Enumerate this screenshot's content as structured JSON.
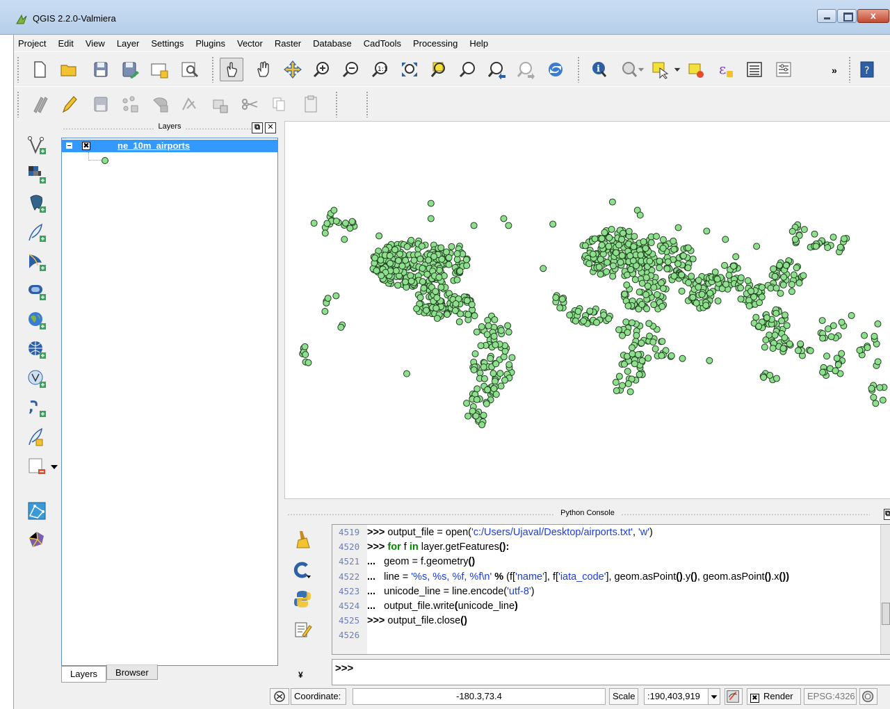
{
  "window": {
    "title": "QGIS 2.2.0-Valmiera"
  },
  "menu": [
    "Project",
    "Edit",
    "View",
    "Layer",
    "Settings",
    "Plugins",
    "Vector",
    "Raster",
    "Database",
    "CadTools",
    "Processing",
    "Help"
  ],
  "toolbar": {
    "file_icons": [
      "new-project-icon",
      "open-project-icon",
      "save-project-icon",
      "save-as-icon",
      "new-print-composer-icon",
      "composer-manager-icon"
    ],
    "nav_icons": [
      "touch-zoom-pan-icon",
      "pan-icon",
      "pan-to-selection-icon",
      "zoom-in-icon",
      "zoom-out-icon",
      "zoom-native-icon",
      "zoom-full-icon",
      "zoom-to-selection-icon",
      "zoom-to-layer-icon",
      "zoom-last-icon",
      "zoom-next-icon",
      "refresh-icon"
    ],
    "attr_icons": [
      "identify-icon",
      "feature-action-icon",
      "select-icon",
      "deselect-icon",
      "field-calculator-icon",
      "attribute-table-icon",
      "measure-icon"
    ],
    "more_label": "»",
    "help_icon": "help-icon"
  },
  "digitize_toolbar": [
    "current-edits-icon",
    "toggle-editing-icon",
    "save-edits-icon",
    "add-feature-icon",
    "move-feature-icon",
    "node-tool-icon",
    "delete-selected-icon",
    "cut-features-icon",
    "copy-features-icon",
    "paste-features-icon"
  ],
  "left_toolbar": [
    "add-vector-layer-icon",
    "add-raster-layer-icon",
    "add-postgis-layer-icon",
    "add-spatialite-layer-icon",
    "add-mssql-layer-icon",
    "add-oracle-layer-icon",
    "add-wms-layer-icon",
    "add-wcs-layer-icon",
    "add-wfs-layer-icon",
    "add-delimited-text-icon",
    "new-shapefile-icon",
    "remove-layer-icon",
    "georeferencer-icon",
    "plugin-manager-icon"
  ],
  "layers_panel": {
    "title": "Layers",
    "layer_name": "ne_10m_airports",
    "checked_glyph": "✖",
    "tabs": [
      "Layers",
      "Browser"
    ],
    "float_glyph": "⧉",
    "close_glyph": "✕"
  },
  "map": {
    "point_fill": "#8fe08e",
    "point_stroke": "#1f3d1f"
  },
  "console": {
    "title": "Python Console",
    "lines": [
      {
        "n": "4519",
        "prompt": ">>>",
        "parts": [
          [
            "t",
            " output_file = open("
          ],
          [
            "s",
            "'c:/Users/Ujaval/Desktop/airports.txt'"
          ],
          [
            "t",
            ", "
          ],
          [
            "s",
            "'w'"
          ],
          [
            "t",
            ")"
          ]
        ]
      },
      {
        "n": "4520",
        "prompt": ">>>",
        "parts": [
          [
            "k",
            " for"
          ],
          [
            "t",
            " f "
          ],
          [
            "k",
            "in"
          ],
          [
            "t",
            " layer.getFeatures"
          ],
          [
            "b",
            "():"
          ]
        ]
      },
      {
        "n": "4521",
        "prompt": "...",
        "parts": [
          [
            "t",
            "   geom = f.geometry"
          ],
          [
            "b",
            "()"
          ]
        ]
      },
      {
        "n": "4522",
        "prompt": "...",
        "parts": [
          [
            "t",
            "   line = "
          ],
          [
            "s",
            "'%s, %s, %f, %f\\n'"
          ],
          [
            "t",
            " "
          ],
          [
            "b",
            "%"
          ],
          [
            "t",
            " (f["
          ],
          [
            "s",
            "'name'"
          ],
          [
            "t",
            "], f["
          ],
          [
            "s",
            "'iata_code'"
          ],
          [
            "t",
            "], geom.asPoint"
          ],
          [
            "b",
            "()"
          ],
          [
            "t",
            ".y"
          ],
          [
            "b",
            "()"
          ],
          [
            "t",
            ", geom.asPoint"
          ],
          [
            "b",
            "()"
          ],
          [
            "t",
            ".x"
          ],
          [
            "b",
            "())"
          ]
        ]
      },
      {
        "n": "4523",
        "prompt": "...",
        "parts": [
          [
            "t",
            "   unicode_line = line.encode("
          ],
          [
            "s",
            "'utf-8'"
          ],
          [
            "t",
            ")"
          ]
        ]
      },
      {
        "n": "4524",
        "prompt": "...",
        "parts": [
          [
            "t",
            "   output_file.write"
          ],
          [
            "b",
            "("
          ],
          [
            "t",
            "unicode_line"
          ],
          [
            "b",
            ")"
          ]
        ]
      },
      {
        "n": "4525",
        "prompt": ">>>",
        "parts": [
          [
            "t",
            " output_file.close"
          ],
          [
            "b",
            "()"
          ]
        ]
      },
      {
        "n": "4526",
        "prompt": "",
        "parts": []
      }
    ],
    "input_prompt": ">>>",
    "side_icons": [
      "clear-console-icon",
      "settings-console-icon",
      "python-editor-icon",
      "show-editor-icon"
    ],
    "collapse_glyph": "¥"
  },
  "statusbar": {
    "coordinate_label": "Coordinate:",
    "coordinate_value": "-180.3,73.4",
    "scale_label": "Scale",
    "scale_value": ":190,403,919",
    "render_label": "Render",
    "render_glyph": "✖",
    "crs": "EPSG:4326"
  }
}
